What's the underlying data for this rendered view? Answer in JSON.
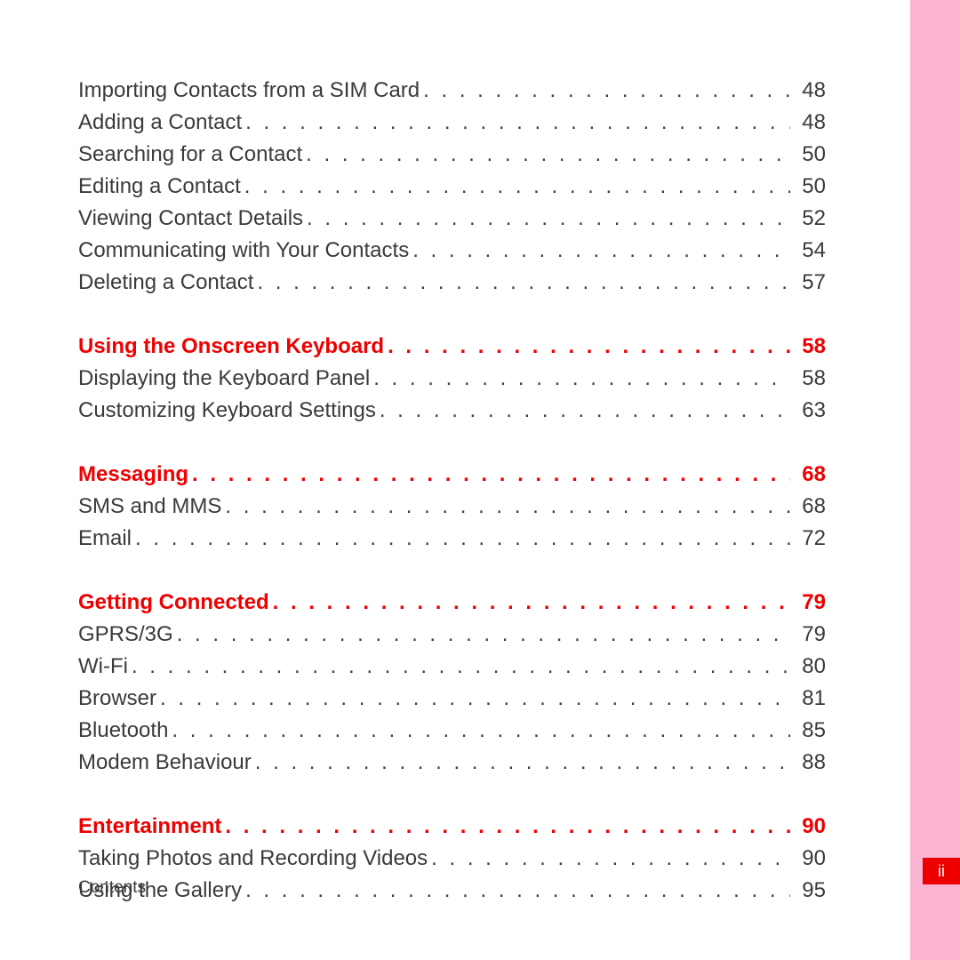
{
  "footer": "Contents",
  "pageNumber": "ii",
  "sections": [
    {
      "heading": null,
      "items": [
        {
          "title": "Importing Contacts from a SIM Card",
          "page": "48"
        },
        {
          "title": "Adding a Contact",
          "page": "48"
        },
        {
          "title": "Searching for a Contact",
          "page": "50"
        },
        {
          "title": "Editing a Contact",
          "page": "50"
        },
        {
          "title": "Viewing Contact Details",
          "page": "52"
        },
        {
          "title": "Communicating with Your Contacts",
          "page": "54"
        },
        {
          "title": "Deleting a Contact",
          "page": "57"
        }
      ]
    },
    {
      "heading": {
        "title": "Using the Onscreen Keyboard",
        "page": "58"
      },
      "items": [
        {
          "title": "Displaying the Keyboard Panel",
          "page": "58"
        },
        {
          "title": "Customizing Keyboard Settings",
          "page": "63"
        }
      ]
    },
    {
      "heading": {
        "title": "Messaging",
        "page": "68"
      },
      "items": [
        {
          "title": "SMS and MMS",
          "page": "68"
        },
        {
          "title": "Email",
          "page": "72"
        }
      ]
    },
    {
      "heading": {
        "title": "Getting Connected",
        "page": "79"
      },
      "items": [
        {
          "title": "GPRS/3G",
          "page": "79"
        },
        {
          "title": "Wi-Fi",
          "page": "80"
        },
        {
          "title": "Browser",
          "page": "81"
        },
        {
          "title": "Bluetooth",
          "page": "85"
        },
        {
          "title": "Modem Behaviour",
          "page": "88"
        }
      ]
    },
    {
      "heading": {
        "title": "Entertainment",
        "page": "90"
      },
      "items": [
        {
          "title": "Taking Photos and Recording Videos",
          "page": "90"
        },
        {
          "title": "Using the Gallery",
          "page": "95"
        }
      ]
    }
  ]
}
